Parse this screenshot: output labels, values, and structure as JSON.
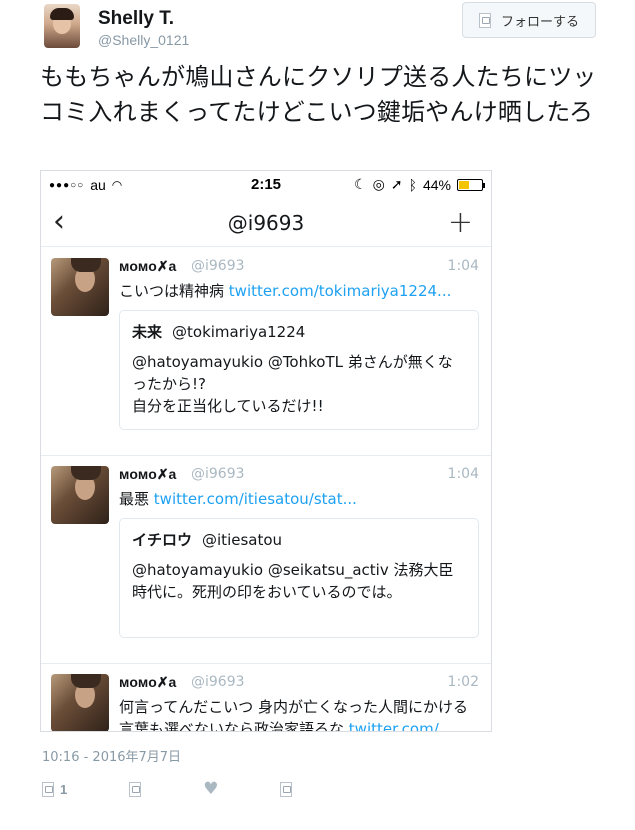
{
  "user": {
    "name": "Shelly T.",
    "handle": "@Shelly_0121"
  },
  "follow_label": "フォローする",
  "tweet": {
    "text": "ももちゃんが鳩山さんにクソリプ送る人たちにツッコミ入れまくってたけどこいつ鍵垢やんけ晒したろ",
    "timestamp": "10:16 - 2016年7月7日",
    "reply_count": "1"
  },
  "screenshot": {
    "status": {
      "carrier": "au",
      "time": "2:15",
      "battery": "44%",
      "battery_level": 0.44
    },
    "nav_title": "@i9693",
    "posts": [
      {
        "name": "ᴍᴏᴍᴏ✗a",
        "handle": "@i9693",
        "time": "1:04",
        "text": "こいつは精神病",
        "link": "twitter.com/tokimariya1224...",
        "quote": {
          "name": "未来",
          "handle": "@tokimariya1224",
          "text": "@hatoyamayukio @TohkoTL 弟さんが無くなったから!?\n自分を正当化しているだけ!!"
        }
      },
      {
        "name": "ᴍᴏᴍᴏ✗a",
        "handle": "@i9693",
        "time": "1:04",
        "text": "最悪",
        "link": "twitter.com/itiesatou/stat...",
        "quote": {
          "name": "イチロウ",
          "handle": "@itiesatou",
          "text": "@hatoyamayukio @seikatsu_activ 法務大臣時代に。死刑の印をおいているのでは。"
        }
      },
      {
        "name": "ᴍᴏᴍᴏ✗a",
        "handle": "@i9693",
        "time": "1:02",
        "text": "何言ってんだこいつ 身内が亡くなった人間にかける言葉も選べないなら政治家語るな",
        "link": "twitter.com/"
      }
    ]
  }
}
